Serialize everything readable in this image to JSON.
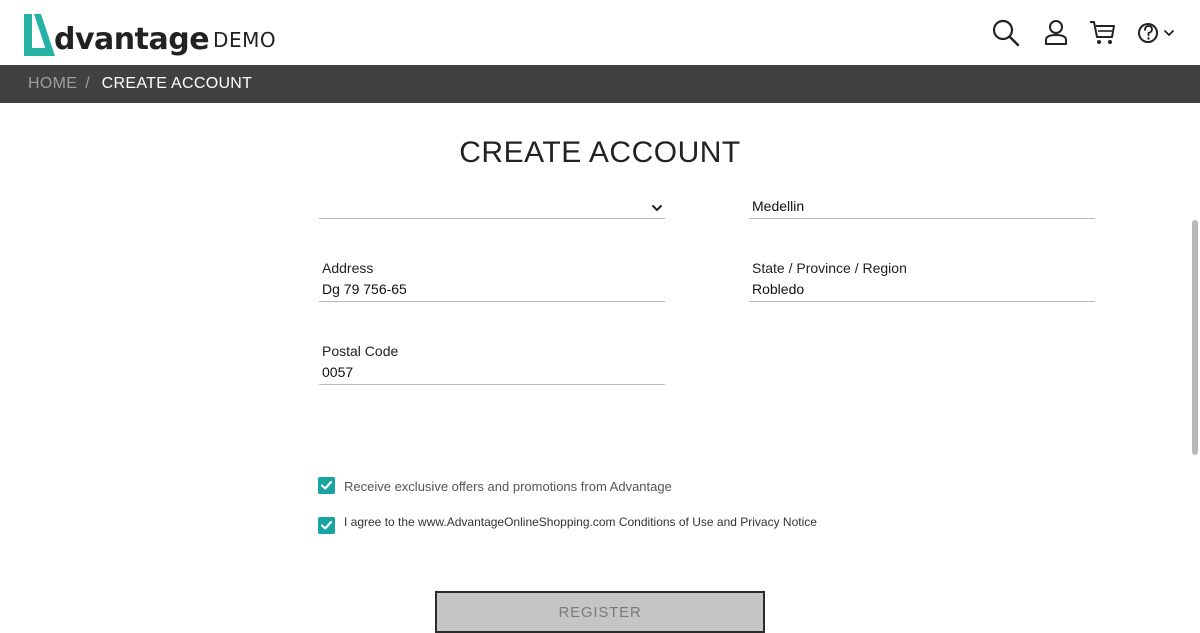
{
  "header": {
    "logo_text": "dvantage",
    "logo_suffix": "DEMO",
    "colors": {
      "brand_teal": "#27b2a6",
      "dark": "#222222"
    },
    "icons": [
      "search-icon",
      "user-icon",
      "cart-icon",
      "help-icon",
      "chevron-down-icon"
    ]
  },
  "breadcrumb": {
    "home": "HOME",
    "separator": "/",
    "current": "CREATE ACCOUNT",
    "bg": "#414141"
  },
  "page": {
    "title": "CREATE ACCOUNT"
  },
  "form": {
    "country": {
      "value": ""
    },
    "city": {
      "value": "Medellin"
    },
    "address": {
      "label": "Address",
      "value": "Dg 79 756-65"
    },
    "state": {
      "label": "State / Province / Region",
      "value": "Robledo"
    },
    "postal": {
      "label": "Postal Code",
      "value": "0057"
    },
    "offers": {
      "label": "Receive exclusive offers and promotions from Advantage",
      "checked": true
    },
    "agree": {
      "label": "I agree to the www.AdvantageOnlineShopping.com Conditions of Use and Privacy Notice",
      "checked": true
    },
    "register_label": "REGISTER"
  }
}
